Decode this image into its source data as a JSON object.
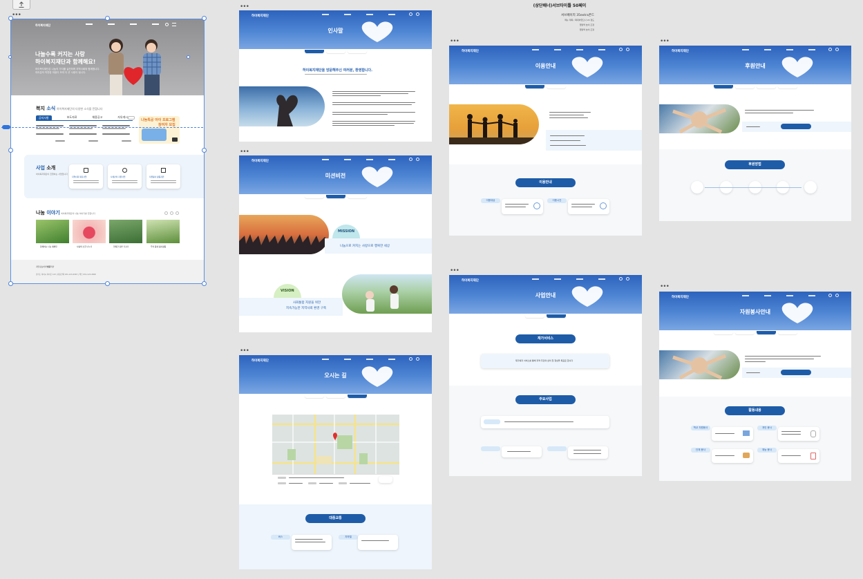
{
  "toolbar": {
    "export_icon": "upload-icon"
  },
  "spec_note": {
    "title": "(상단배너)서브타이틀 50페이",
    "subtitle": "서브페이지 35extra폰드",
    "lines": [
      "메뉴 제목 / 확대하였으나 24 정도",
      "탭영역 높이 조정",
      "탭영역 높이 조정"
    ]
  },
  "main": {
    "logo": "하이복지재단",
    "hero_headline_1": "나눌수록 커지는 사랑",
    "hero_headline_2": "하이복지재단과 함께해요!",
    "hero_sub_1": "하이복지재단은 나눔의 가치를 실천하며 지역사회와 함께합니다.",
    "hero_sub_2": "여러분의 따뜻한 마음이 모여 더 큰 사랑이 됩니다.",
    "news_title_plain": "복지 ",
    "news_title_strong": "소식",
    "news_desc": "하이복지재단의 다양한 소식을 전합니다",
    "news_tabs": [
      "공지사항",
      "보도자료",
      "채용공고",
      "자유게시"
    ],
    "banner_text_1": "나눔특공 아이 프로그램",
    "banner_text_2": "참여자 모집",
    "business_title_plain": "사업 ",
    "business_title_strong": "소개",
    "business_desc": "하이복지재단이 진행하는 사업입니다",
    "business_cards": [
      "지역사회 복지사업",
      "사례관리 지원사업",
      "자원봉사 활동지원"
    ],
    "story_title_plain": "나눔 ",
    "story_title_strong": "이야기",
    "story_desc": "하이복지재단의 나눔 이야기를 전합니다",
    "stories": [
      "함께하는 나눔 캠페인",
      "사랑의 손길 나누기",
      "행복한 텃밭 가꾸기",
      "우리 동네 봉사활동"
    ],
    "footer_links": [
      "개인정보처리방침",
      "이용약관"
    ],
    "footer_info": "경기도 하이시 하이로 123 | 대표전화 031-123-4567 | 팩스 031-123-4568"
  },
  "boards": {
    "greeting": {
      "title": "인사말",
      "heading": "하이복지재단을 방문해주신 여러분, 환영합니다.",
      "tabs": [
        "인사말",
        "미션비전",
        "오시는길"
      ]
    },
    "mission": {
      "title": "미션비전",
      "mission_label": "MISSION",
      "mission_text": "나눔으로 커지는 사랑으로 행복한 세상",
      "vision_label": "VISION",
      "vision_text_1": "사회통합 지원을 위한",
      "vision_text_2": "지속가능한 지역사회 환경 구축"
    },
    "directions": {
      "title": "오시는 길",
      "traffic_pill": "대중교통",
      "bus_label": "버스",
      "subway_label": "지하철"
    },
    "usage": {
      "title": "이용안내",
      "info_pill": "이용안내",
      "label_a": "이용대상",
      "label_b": "이용시간"
    },
    "business": {
      "title": "사업안내",
      "pill_1": "재가서비스",
      "pill_2": "주요사업",
      "desc": "재가복지 서비스를 통해 지역 주민의 삶의 질 향상을 목표로 합니다"
    },
    "sponsor": {
      "title": "후원안내",
      "pill": "후원방법"
    },
    "volunteer": {
      "title": "자원봉사안내",
      "pill": "활동내용",
      "labels": [
        "학교 자원봉사",
        "개인 봉사",
        "단체 봉사",
        "재능 봉사"
      ]
    }
  },
  "colors": {
    "primary": "#1e5ca8",
    "header_top": "#2d63bd",
    "accent_light": "#d7e8f8",
    "canvas": "#e4e4e4",
    "selection": "#4b82dd"
  }
}
